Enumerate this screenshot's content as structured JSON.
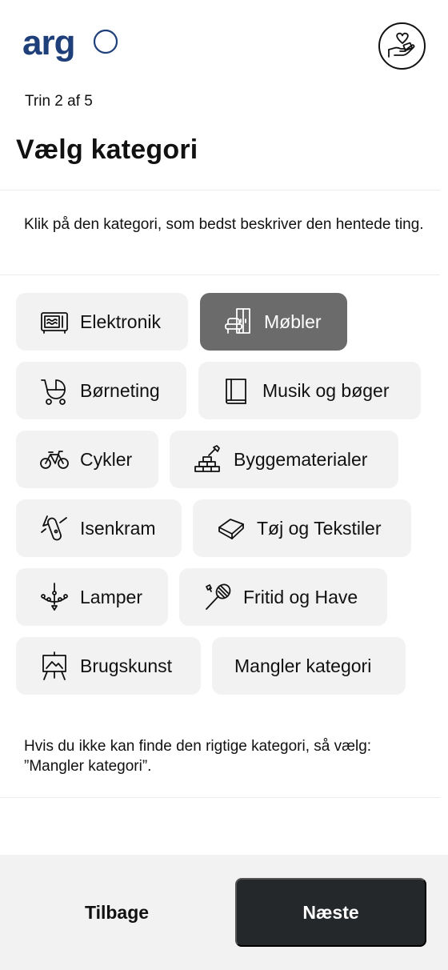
{
  "header": {
    "logo_text": "argo",
    "donate_icon": "heart-in-hand-icon"
  },
  "step_label": "Trin 2 af 5",
  "title": "Vælg kategori",
  "intro": "Klik på den kategori, som bedst beskriver den hentede ting.",
  "categories": [
    {
      "label": "Elektronik",
      "icon": "microwave-icon",
      "selected": false
    },
    {
      "label": "Møbler",
      "icon": "furniture-icon",
      "selected": true
    },
    {
      "label": "Børneting",
      "icon": "stroller-icon",
      "selected": false
    },
    {
      "label": "Musik og bøger",
      "icon": "book-icon",
      "selected": false
    },
    {
      "label": "Cykler",
      "icon": "bicycle-icon",
      "selected": false
    },
    {
      "label": "Byggematerialer",
      "icon": "bricks-trowel-icon",
      "selected": false
    },
    {
      "label": "Isenkram",
      "icon": "pocket-knife-icon",
      "selected": false
    },
    {
      "label": "Tøj og Tekstiler",
      "icon": "folded-cloth-icon",
      "selected": false
    },
    {
      "label": "Lamper",
      "icon": "chandelier-icon",
      "selected": false
    },
    {
      "label": "Fritid og Have",
      "icon": "badminton-icon",
      "selected": false
    },
    {
      "label": "Brugskunst",
      "icon": "easel-icon",
      "selected": false
    },
    {
      "label": "Mangler kategori",
      "icon": "",
      "selected": false
    }
  ],
  "footnote": "Hvis du ikke kan finde den rigtige kategori, så vælg: ”Mangler kategori”.",
  "footer": {
    "back_label": "Tilbage",
    "next_label": "Næste"
  },
  "colors": {
    "brand_blue": "#1f3f7a",
    "selected_bg": "#6b6b6b",
    "chip_bg": "#f2f2f2",
    "primary_button": "#25282b"
  }
}
